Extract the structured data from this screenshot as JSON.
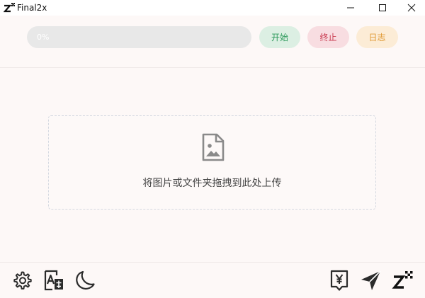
{
  "window": {
    "title": "Final2x"
  },
  "progress": {
    "value_percent": 0,
    "text": "0%"
  },
  "toolbar": {
    "start_label": "开始",
    "stop_label": "终止",
    "log_label": "日志"
  },
  "dropzone": {
    "text": "将图片或文件夹拖拽到此处上传"
  },
  "colors": {
    "start_bg": "#dcefe3",
    "start_fg": "#2e9a5c",
    "stop_bg": "#f8dde1",
    "stop_fg": "#c93a4f",
    "log_bg": "#fcecd6",
    "log_fg": "#e09a35"
  },
  "icons": {
    "bottom_left": [
      "gear-icon",
      "translate-icon",
      "moon-icon"
    ],
    "bottom_right": [
      "donate-icon",
      "send-icon",
      "final2x-logo-icon"
    ]
  }
}
